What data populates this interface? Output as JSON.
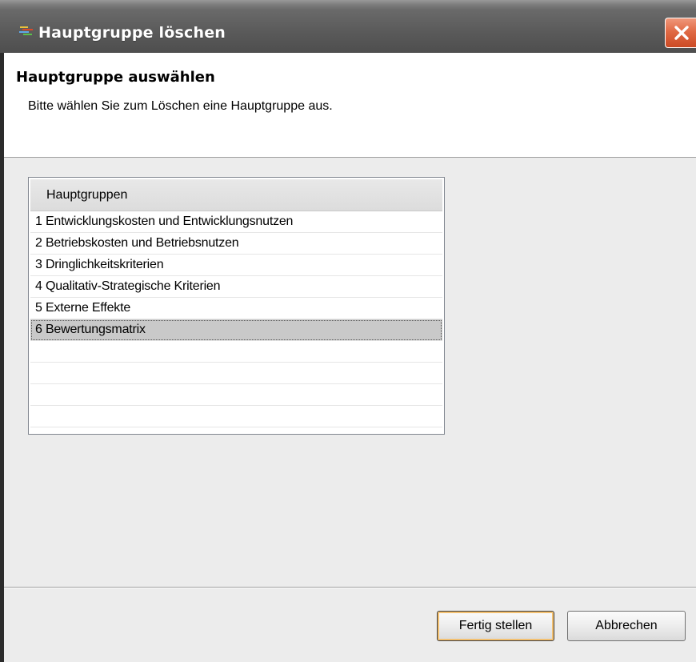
{
  "window": {
    "title": "Hauptgruppe löschen",
    "app_icon": "app-icon",
    "close_icon": "close-icon"
  },
  "header": {
    "title": "Hauptgruppe auswählen",
    "description": "Bitte wählen Sie zum Löschen eine Hauptgruppe aus."
  },
  "list": {
    "column_header": "Hauptgruppen",
    "items": [
      "1 Entwicklungskosten und Entwicklungsnutzen",
      "2 Betriebskosten und Betriebsnutzen",
      "3 Dringlichkeitskriterien",
      "4 Qualitativ-Strategische Kriterien",
      "5 Externe Effekte",
      "6 Bewertungsmatrix"
    ],
    "selected_index": 5
  },
  "footer": {
    "finish_label": "Fertig stellen",
    "cancel_label": "Abbrechen"
  },
  "colors": {
    "close_button": "#d9552f",
    "selection": "#c9c9c9",
    "default_button_border": "#f3c070"
  }
}
